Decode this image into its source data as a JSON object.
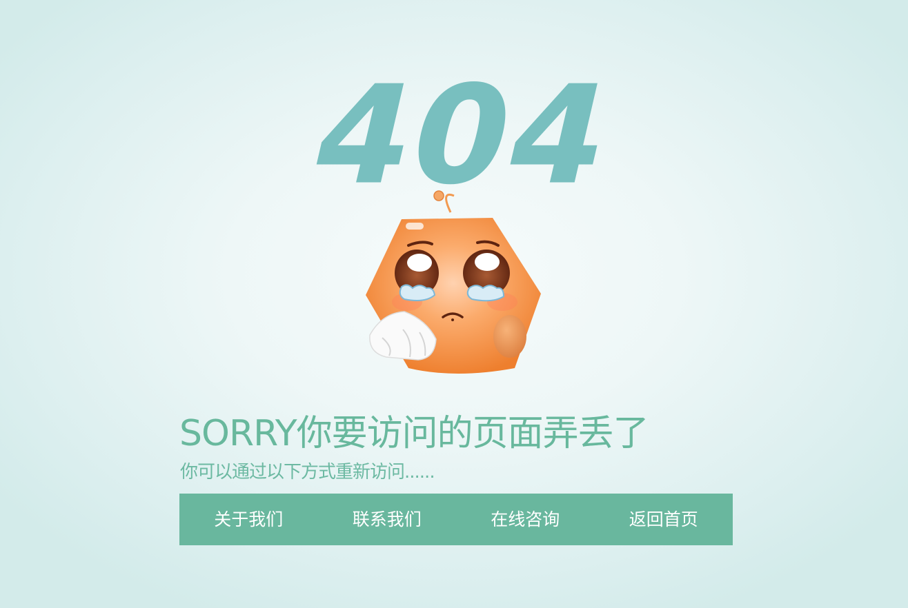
{
  "error_code": "404",
  "headline": "SORRY你要访问的页面弄丢了",
  "subtext": "你可以通过以下方式重新访问......",
  "nav": {
    "items": [
      {
        "label": "关于我们"
      },
      {
        "label": "联系我们"
      },
      {
        "label": "在线咨询"
      },
      {
        "label": "返回首页"
      }
    ]
  },
  "mascot": {
    "icon": "crying-hexagon-mascot-icon"
  },
  "colors": {
    "accent": "#69b79e",
    "code": "#78bfbf",
    "mascot": "#f08a3c",
    "background": "#eaf5f5"
  }
}
